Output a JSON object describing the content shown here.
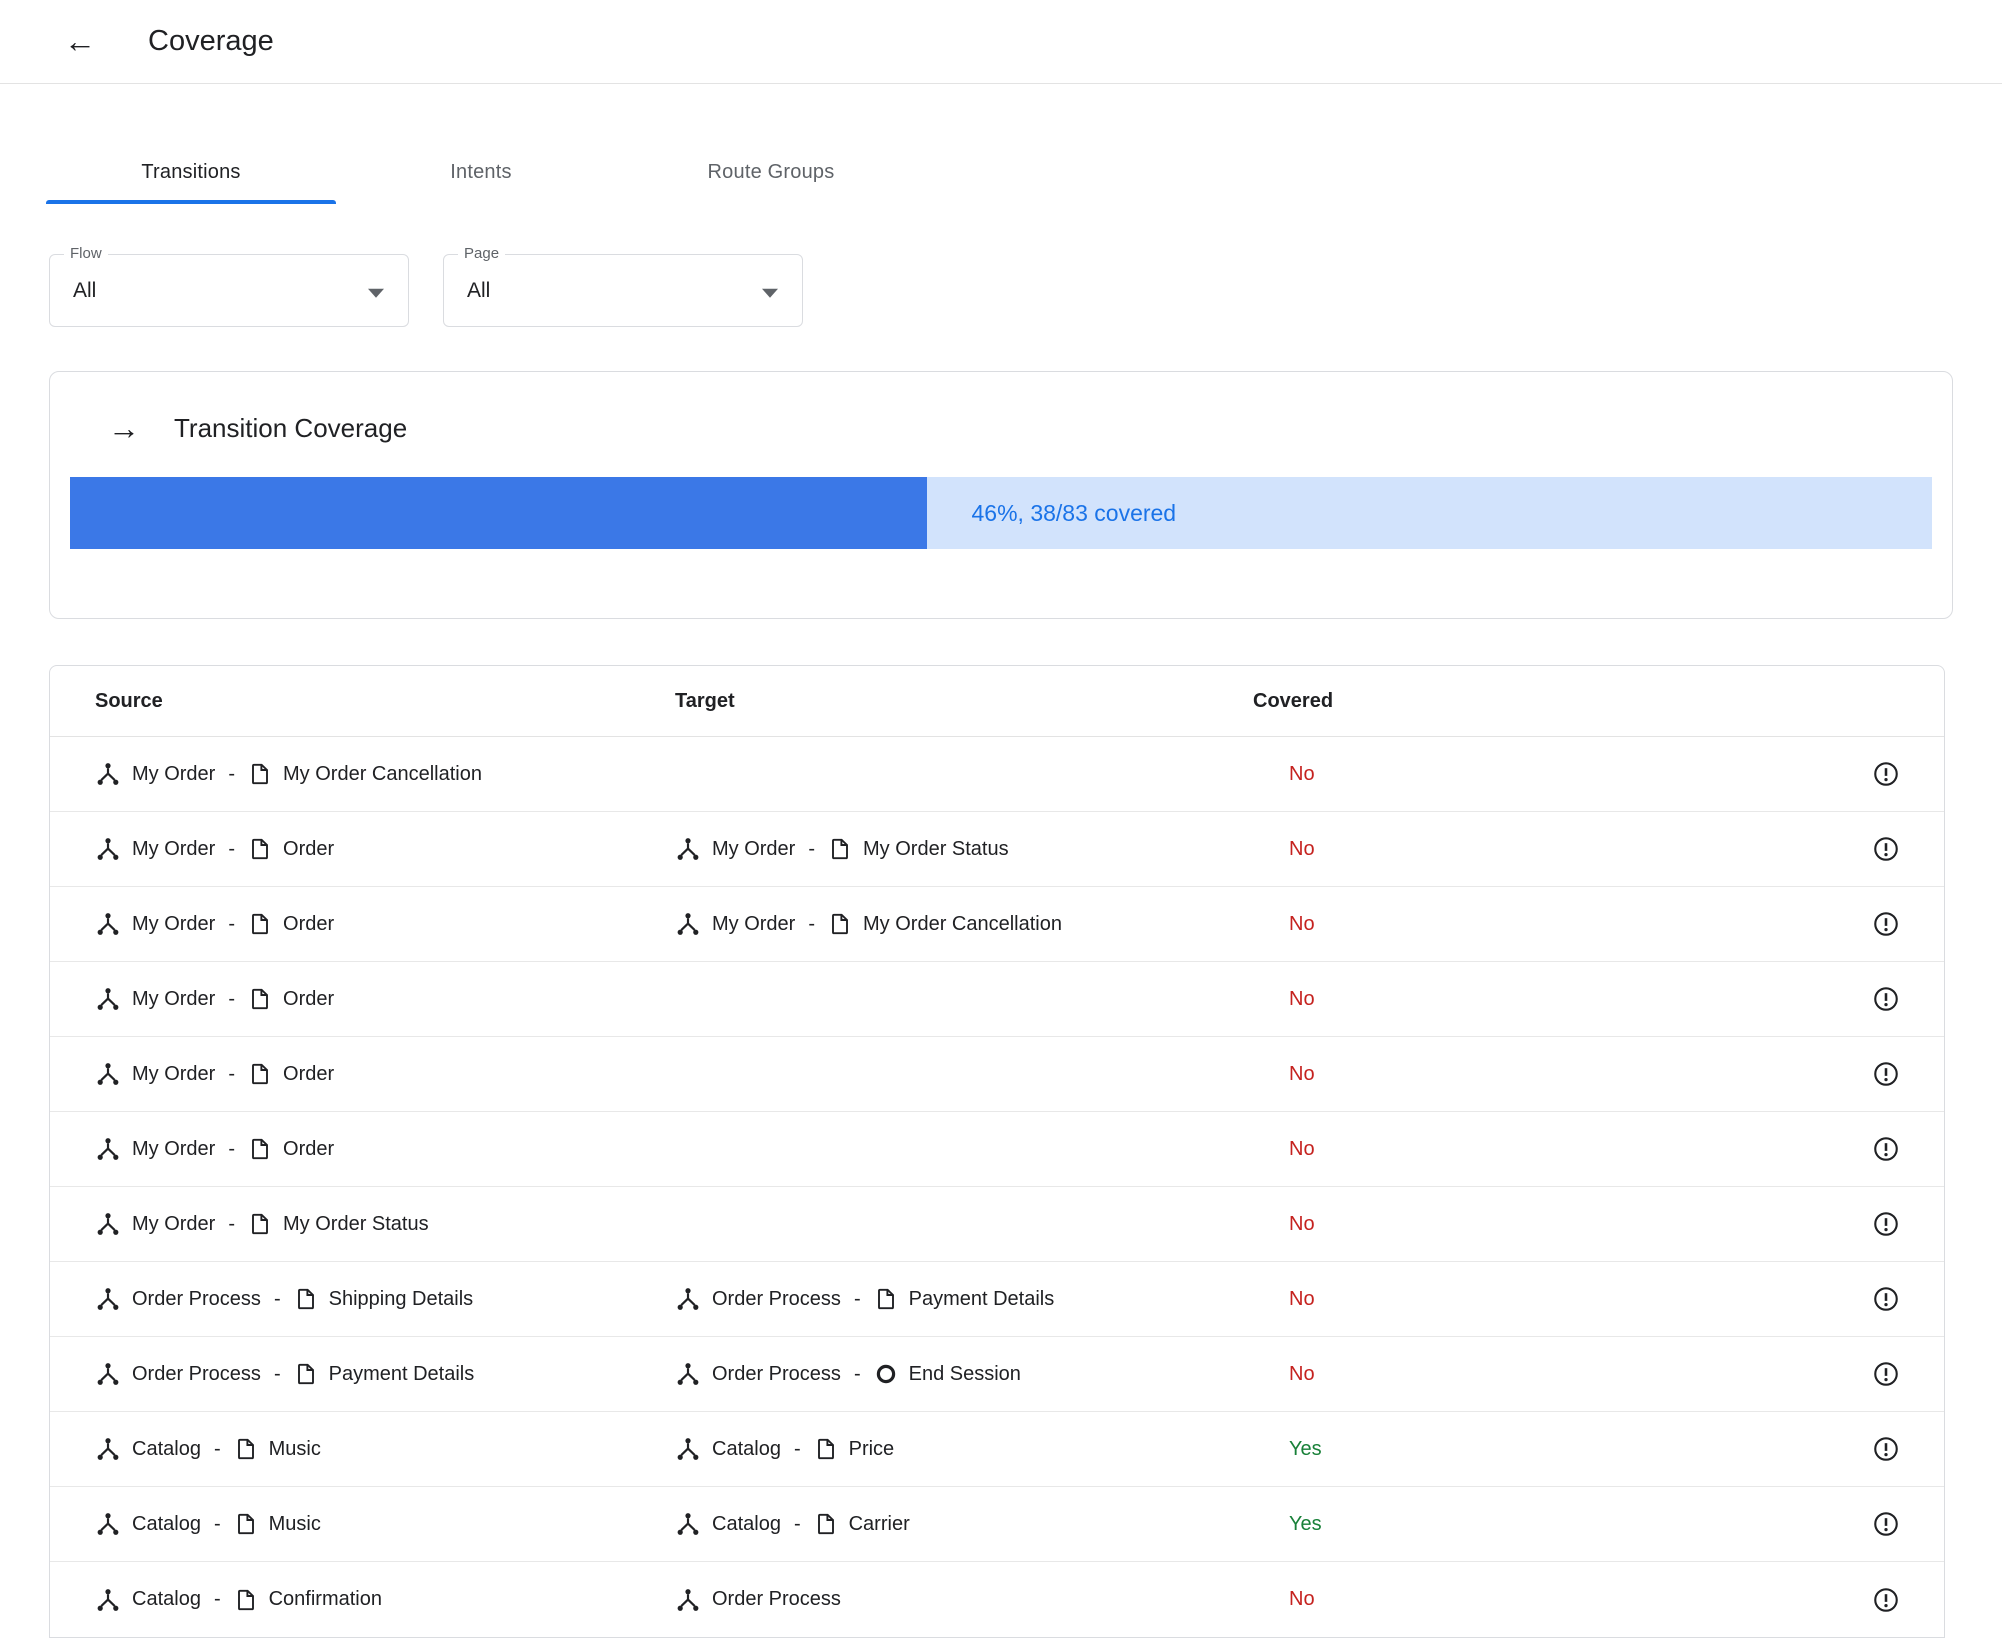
{
  "header": {
    "title": "Coverage"
  },
  "tabs": [
    {
      "label": "Transitions",
      "active": true
    },
    {
      "label": "Intents",
      "active": false
    },
    {
      "label": "Route Groups",
      "active": false
    }
  ],
  "filters": {
    "flow": {
      "label": "Flow",
      "value": "All"
    },
    "page": {
      "label": "Page",
      "value": "All"
    }
  },
  "coverage_card": {
    "title": "Transition Coverage",
    "percent": 46,
    "progress_label": "46%, 38/83 covered"
  },
  "table": {
    "columns": [
      "Source",
      "Target",
      "Covered"
    ],
    "rows": [
      {
        "source": {
          "flow": "My Order",
          "page": "My Order Cancellation"
        },
        "target": null,
        "covered": "No"
      },
      {
        "source": {
          "flow": "My Order",
          "page": "Order"
        },
        "target": {
          "flow": "My Order",
          "page": "My Order Status",
          "type": "page"
        },
        "covered": "No"
      },
      {
        "source": {
          "flow": "My Order",
          "page": "Order"
        },
        "target": {
          "flow": "My Order",
          "page": "My Order Cancellation",
          "type": "page"
        },
        "covered": "No"
      },
      {
        "source": {
          "flow": "My Order",
          "page": "Order"
        },
        "target": null,
        "covered": "No"
      },
      {
        "source": {
          "flow": "My Order",
          "page": "Order"
        },
        "target": null,
        "covered": "No"
      },
      {
        "source": {
          "flow": "My Order",
          "page": "Order"
        },
        "target": null,
        "covered": "No"
      },
      {
        "source": {
          "flow": "My Order",
          "page": "My Order Status"
        },
        "target": null,
        "covered": "No"
      },
      {
        "source": {
          "flow": "Order Process",
          "page": "Shipping Details"
        },
        "target": {
          "flow": "Order Process",
          "page": "Payment Details",
          "type": "page"
        },
        "covered": "No"
      },
      {
        "source": {
          "flow": "Order Process",
          "page": "Payment Details"
        },
        "target": {
          "flow": "Order Process",
          "page": "End Session",
          "type": "end-session"
        },
        "covered": "No"
      },
      {
        "source": {
          "flow": "Catalog",
          "page": "Music"
        },
        "target": {
          "flow": "Catalog",
          "page": "Price",
          "type": "page"
        },
        "covered": "Yes"
      },
      {
        "source": {
          "flow": "Catalog",
          "page": "Music"
        },
        "target": {
          "flow": "Catalog",
          "page": "Carrier",
          "type": "page"
        },
        "covered": "Yes"
      },
      {
        "source": {
          "flow": "Catalog",
          "page": "Confirmation"
        },
        "target": {
          "flow": "Order Process",
          "page": null,
          "type": "page"
        },
        "covered": "No"
      }
    ]
  },
  "colors": {
    "accent": "#1a73e8",
    "bar_fill": "#3b78e7",
    "bar_bg": "#d2e3fc",
    "covered_no": "#c5221f",
    "covered_yes": "#188038"
  }
}
